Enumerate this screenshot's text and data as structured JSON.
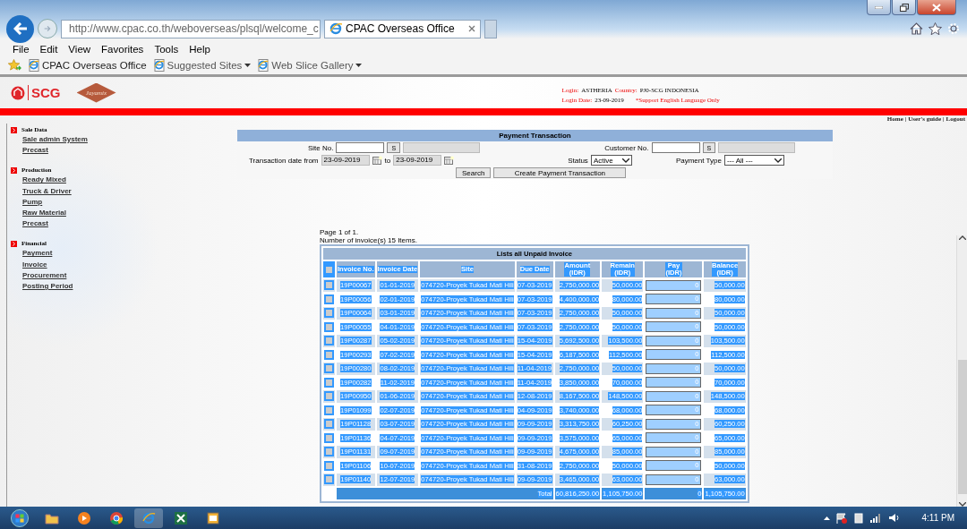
{
  "browser": {
    "url": "http://www.cpac.co.th/weboverseas/plsql/welcome_c",
    "tab_title": "CPAC Overseas Office",
    "menu": [
      "File",
      "Edit",
      "View",
      "Favorites",
      "Tools",
      "Help"
    ],
    "favorites": [
      {
        "label": "CPAC Overseas Office",
        "dropdown": false
      },
      {
        "label": "Suggested Sites",
        "dropdown": true
      },
      {
        "label": "Web Slice Gallery",
        "dropdown": true
      }
    ]
  },
  "header": {
    "brand": "SCG",
    "logo_script": "Jayamix",
    "login_label": "Login:",
    "login": "ASTHERIA",
    "country_label": "Country:",
    "country": "PJ0-SCG INDONESIA",
    "login_date_label": "Login Date:",
    "login_date": "23-09-2019",
    "notice": "*Support English Language Only",
    "links": [
      "Home",
      "User's guide",
      "Logout"
    ],
    "separator": "|"
  },
  "sidebar": [
    {
      "title": "Sale Data",
      "items": [
        "Sale admin System",
        "Precast"
      ]
    },
    {
      "title": "Production",
      "items": [
        "Ready Mixed",
        "Truck & Driver",
        "Pump",
        "Raw Material",
        "Precast"
      ]
    },
    {
      "title": "Financial",
      "items": [
        "Payment",
        "Invoice",
        "Procurement",
        "Posting Period"
      ]
    }
  ],
  "form": {
    "title": "Payment Transaction",
    "site_label": "Site No.",
    "site_button": "S",
    "customer_label": "Customer No.",
    "customer_button": "S",
    "date_label": "Transaction date from",
    "date_from": "23-09-2019",
    "to_label": "to",
    "date_to": "23-09-2019",
    "status_label": "Status",
    "status": "Active",
    "payment_type_label": "Payment Type",
    "payment_type": "--- All ---",
    "buttons": [
      "Search",
      "Create Payment Transaction"
    ]
  },
  "list": {
    "page_info": "Page 1 of 1.",
    "count": "Number of invoice(s) 15 Items.",
    "title": "Lists all Unpaid Invoice",
    "header_checked": false,
    "columns": [
      "Invoice No.",
      "Invoice Date",
      "Site",
      "Due Date",
      "Amount\n(IDR)",
      "Remain\n(IDR)",
      "Pay\n(IDR)",
      "Balance\n(IDR)"
    ],
    "rows": [
      {
        "checked": false,
        "cells": [
          "19P00067",
          "01-01-2019",
          "074720-Proyek Tukad Mati Hili",
          "07-03-2019",
          "2,750,000.00",
          "50,000.00"
        ],
        "pay": "0",
        "balance": "50,000.00"
      },
      {
        "checked": false,
        "cells": [
          "19P00056",
          "02-01-2019",
          "074720-Proyek Tukad Mati Hili",
          "07-03-2019",
          "4,400,000.00",
          "80,000.00"
        ],
        "pay": "0",
        "balance": "80,000.00"
      },
      {
        "checked": false,
        "cells": [
          "19P00064",
          "03-01-2019",
          "074720-Proyek Tukad Mati Hili",
          "07-03-2019",
          "2,750,000.00",
          "50,000.00"
        ],
        "pay": "0",
        "balance": "50,000.00"
      },
      {
        "checked": false,
        "cells": [
          "19P00055",
          "04-01-2019",
          "074720-Proyek Tukad Mati Hili",
          "07-03-2019",
          "2,750,000.00",
          "50,000.00"
        ],
        "pay": "0",
        "balance": "50,000.00"
      },
      {
        "checked": false,
        "cells": [
          "19P00287",
          "05-02-2019",
          "074720-Proyek Tukad Mati Hili",
          "15-04-2019",
          "5,692,500.00",
          "103,500.00"
        ],
        "pay": "0",
        "balance": "103,500.00"
      },
      {
        "checked": false,
        "cells": [
          "19P00293",
          "07-02-2019",
          "074720-Proyek Tukad Mati Hili",
          "15-04-2019",
          "6,187,500.00",
          "112,500.00"
        ],
        "pay": "0",
        "balance": "112,500.00"
      },
      {
        "checked": false,
        "cells": [
          "19P00280",
          "08-02-2019",
          "074720-Proyek Tukad Mati Hili",
          "11-04-2019",
          "2,750,000.00",
          "50,000.00"
        ],
        "pay": "0",
        "balance": "50,000.00"
      },
      {
        "checked": false,
        "cells": [
          "19P00282",
          "11-02-2019",
          "074720-Proyek Tukad Mati Hili",
          "11-04-2019",
          "3,850,000.00",
          "70,000.00"
        ],
        "pay": "0",
        "balance": "70,000.00"
      },
      {
        "checked": false,
        "cells": [
          "19P00950",
          "01-06-2019",
          "074720-Proyek Tukad Mati Hili",
          "12-08-2019",
          "8,167,500.00",
          "148,500.00"
        ],
        "pay": "0",
        "balance": "148,500.00"
      },
      {
        "checked": false,
        "cells": [
          "19P01099",
          "02-07-2019",
          "074720-Proyek Tukad Mati Hili",
          "04-09-2019",
          "3,740,000.00",
          "68,000.00"
        ],
        "pay": "0",
        "balance": "68,000.00"
      },
      {
        "checked": false,
        "cells": [
          "19P01128",
          "03-07-2019",
          "074720-Proyek Tukad Mati Hili",
          "09-09-2019",
          "3,313,750.00",
          "60,250.00"
        ],
        "pay": "0",
        "balance": "60,250.00"
      },
      {
        "checked": false,
        "cells": [
          "19P01136",
          "04-07-2019",
          "074720-Proyek Tukad Mati Hili",
          "09-09-2019",
          "3,575,000.00",
          "65,000.00"
        ],
        "pay": "0",
        "balance": "65,000.00"
      },
      {
        "checked": false,
        "cells": [
          "19P01131",
          "09-07-2019",
          "074720-Proyek Tukad Mati Hili",
          "09-09-2019",
          "4,675,000.00",
          "85,000.00"
        ],
        "pay": "0",
        "balance": "85,000.00"
      },
      {
        "checked": false,
        "cells": [
          "19P01106",
          "10-07-2019",
          "074720-Proyek Tukad Mati Hili",
          "31-08-2019",
          "2,750,000.00",
          "50,000.00"
        ],
        "pay": "0",
        "balance": "50,000.00"
      },
      {
        "checked": false,
        "cells": [
          "19P01140",
          "12-07-2019",
          "074720-Proyek Tukad Mati Hili",
          "09-09-2019",
          "3,465,000.00",
          "63,000.00"
        ],
        "pay": "0",
        "balance": "63,000.00"
      }
    ],
    "total": {
      "label": "Total",
      "amount": "60,816,250.00",
      "remain": "1,105,750.00",
      "pay": "0",
      "balance": "1,105,750.00"
    }
  },
  "taskbar": {
    "time": "4:11 PM"
  }
}
